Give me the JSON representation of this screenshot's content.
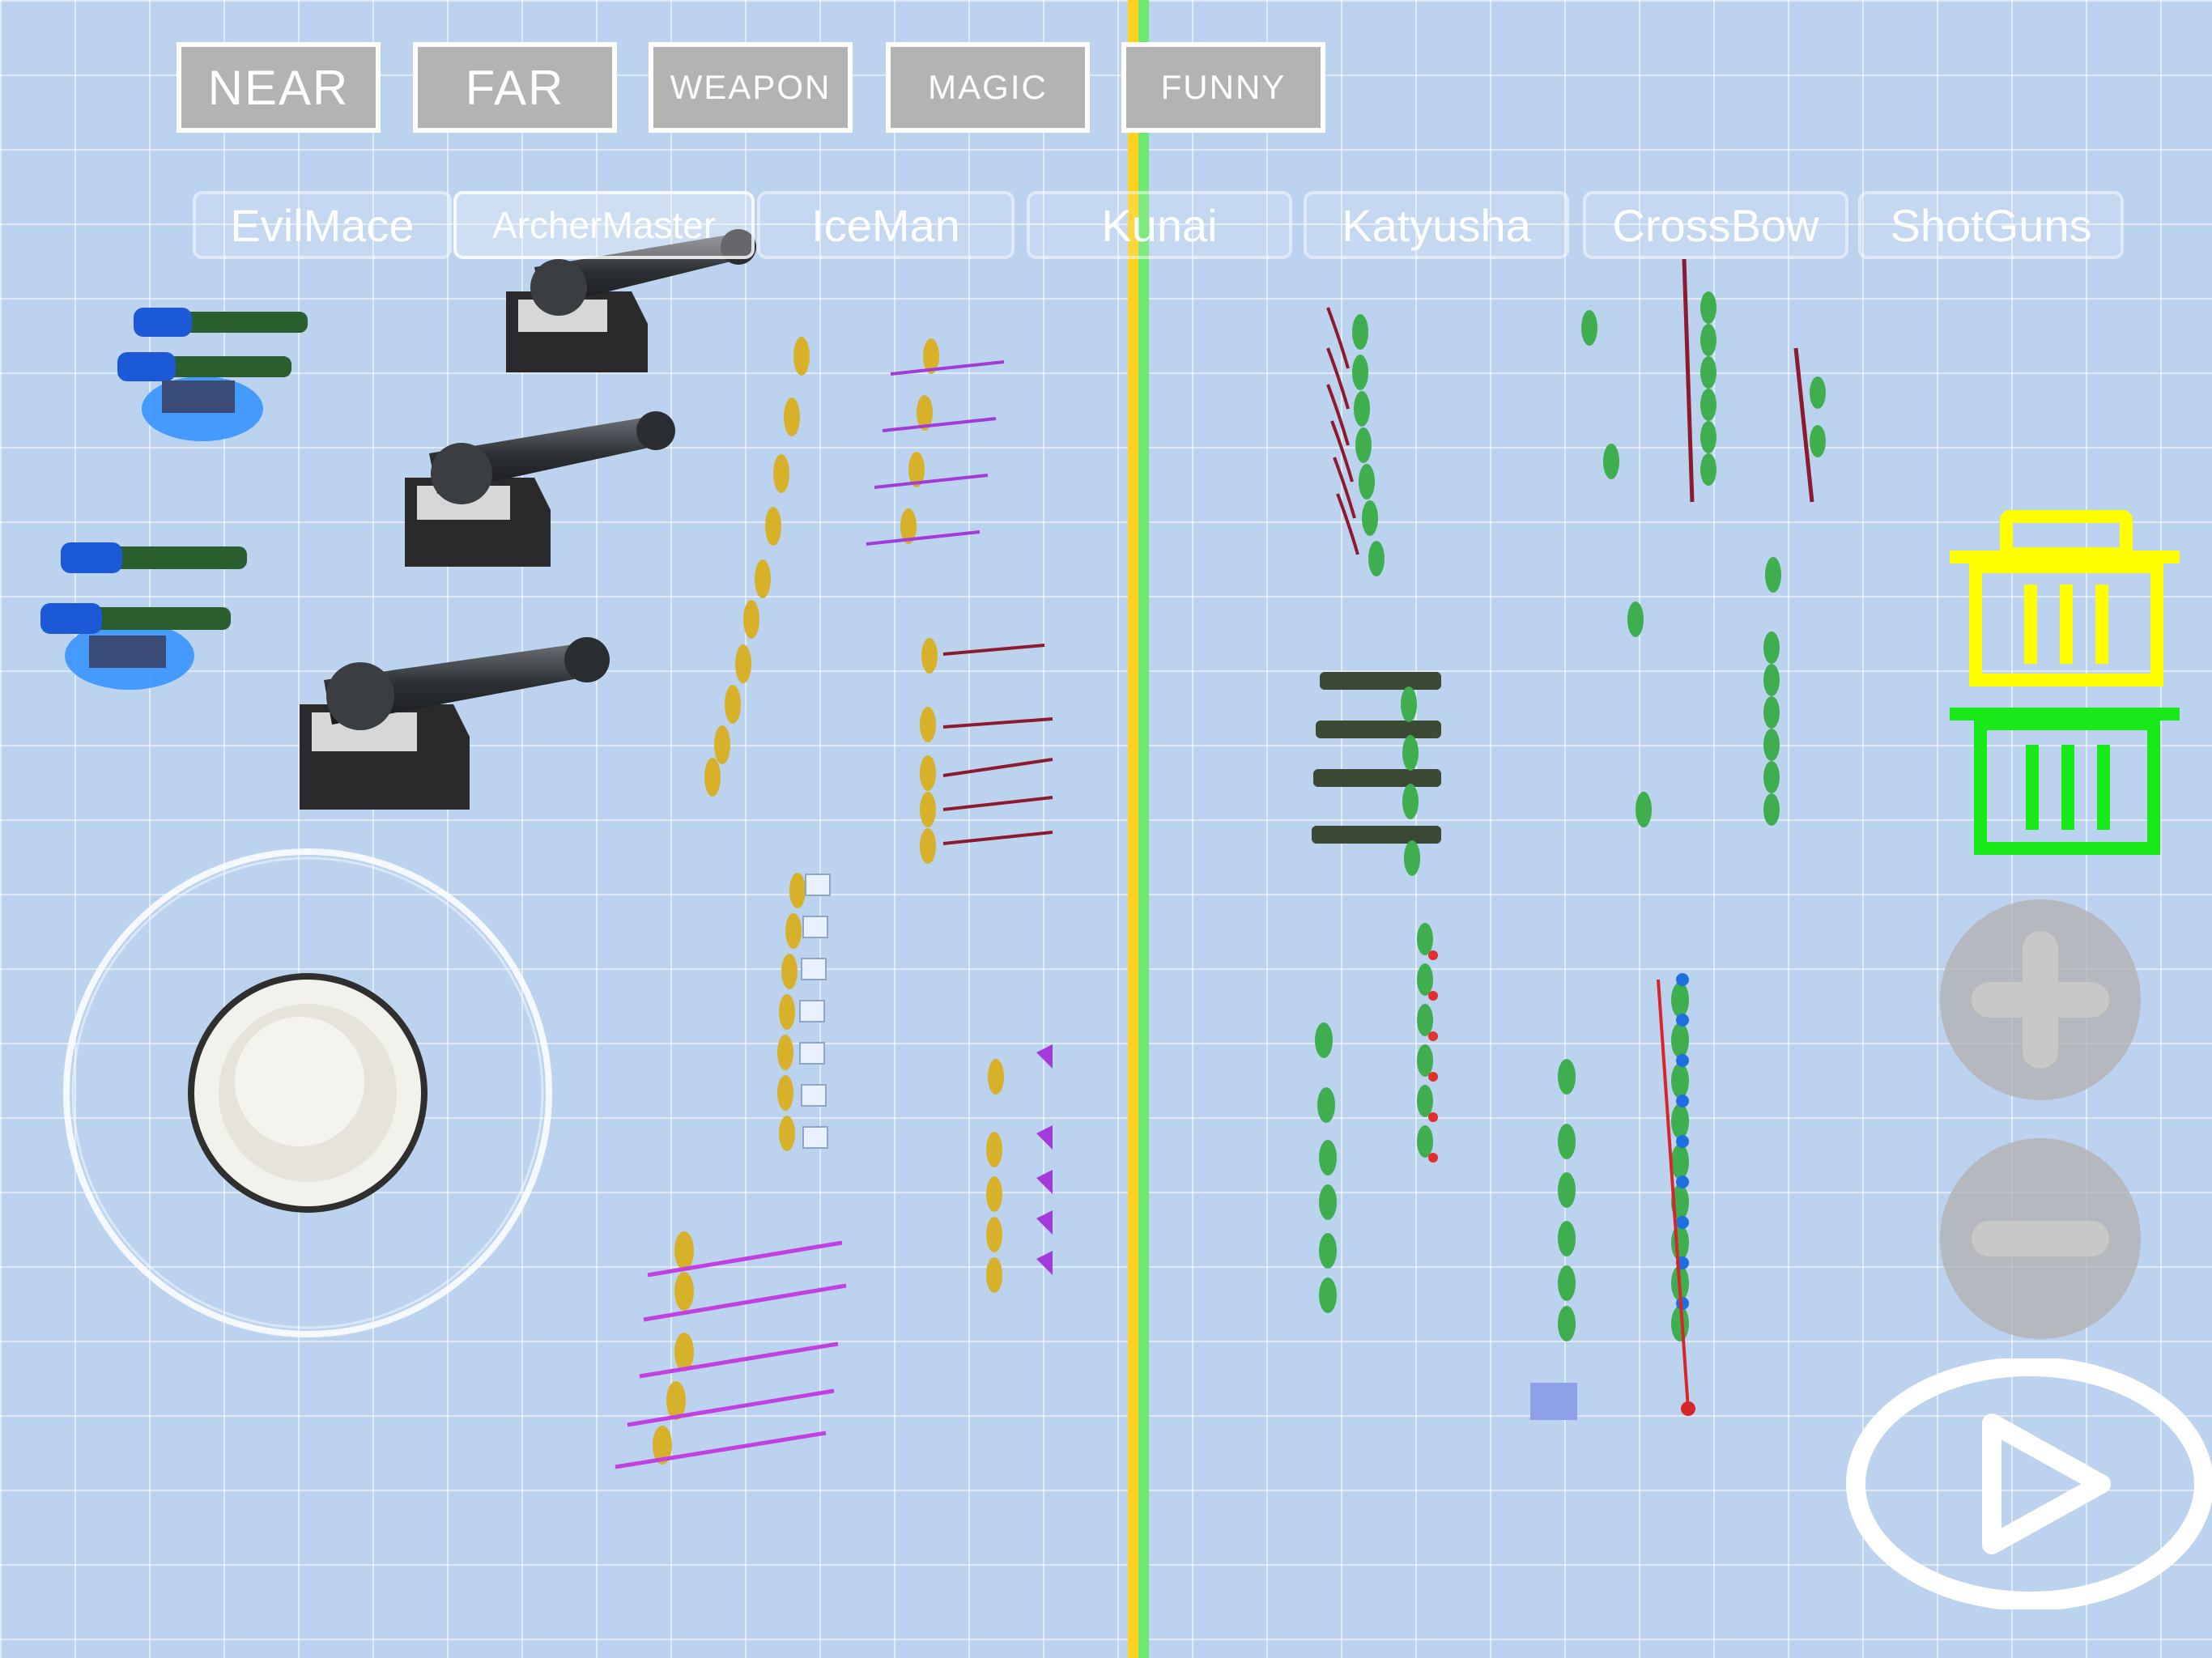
{
  "category_tabs": [
    {
      "label": "NEAR"
    },
    {
      "label": "FAR"
    },
    {
      "label": "WEAPON"
    },
    {
      "label": "MAGIC"
    },
    {
      "label": "FUNNY"
    }
  ],
  "unit_tabs": [
    {
      "label": "EvilMace",
      "selected": false
    },
    {
      "label": "ArcherMaster",
      "selected": true
    },
    {
      "label": "IceMan",
      "selected": false
    },
    {
      "label": "Kunai",
      "selected": false
    },
    {
      "label": "Katyusha",
      "selected": false
    },
    {
      "label": "CrossBow",
      "selected": false
    },
    {
      "label": "ShotGuns",
      "selected": false
    }
  ],
  "colors": {
    "field": "#bcd3f0",
    "grid": "#ffffff",
    "divider_left": "#ffd21f",
    "divider_right": "#6fe86f",
    "yellow_team": "#d8b12a",
    "green_team": "#3fae4f",
    "trash_yellow": "#ffff00",
    "trash_green": "#19e819",
    "button_gray": "#b3b3b3"
  },
  "icons": {
    "trash_yellow": "trash-icon",
    "trash_green": "trash-icon",
    "zoom_in": "plus-icon",
    "zoom_out": "minus-icon",
    "play": "play-icon",
    "joystick": "joystick-icon"
  },
  "footer": {
    "left_text": "",
    "right_text": ""
  }
}
